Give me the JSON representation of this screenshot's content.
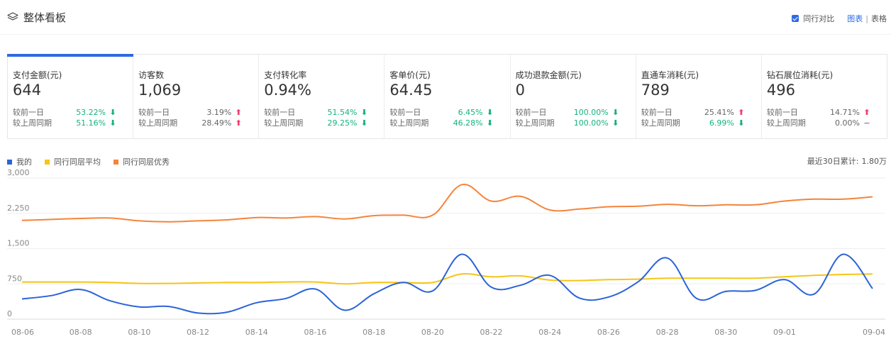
{
  "header": {
    "title": "整体看板",
    "compare_label": "同行对比",
    "compare_checked": true,
    "view_chart": "图表",
    "view_sep": "|",
    "view_table": "表格"
  },
  "cards": [
    {
      "label": "支付金额(元)",
      "value": "644",
      "active": true,
      "rows": [
        {
          "label": "较前一日",
          "pct": "53.22%",
          "dir": "down"
        },
        {
          "label": "较上周同期",
          "pct": "51.16%",
          "dir": "down"
        }
      ]
    },
    {
      "label": "访客数",
      "value": "1,069",
      "active": false,
      "rows": [
        {
          "label": "较前一日",
          "pct": "3.19%",
          "dir": "up"
        },
        {
          "label": "较上周同期",
          "pct": "28.49%",
          "dir": "up"
        }
      ]
    },
    {
      "label": "支付转化率",
      "value": "0.94%",
      "active": false,
      "rows": [
        {
          "label": "较前一日",
          "pct": "51.54%",
          "dir": "down"
        },
        {
          "label": "较上周同期",
          "pct": "29.25%",
          "dir": "down"
        }
      ]
    },
    {
      "label": "客单价(元)",
      "value": "64.45",
      "active": false,
      "rows": [
        {
          "label": "较前一日",
          "pct": "6.45%",
          "dir": "down"
        },
        {
          "label": "较上周同期",
          "pct": "46.28%",
          "dir": "down"
        }
      ]
    },
    {
      "label": "成功退款金额(元)",
      "value": "0",
      "active": false,
      "rows": [
        {
          "label": "较前一日",
          "pct": "100.00%",
          "dir": "down"
        },
        {
          "label": "较上周同期",
          "pct": "100.00%",
          "dir": "down"
        }
      ]
    },
    {
      "label": "直通车消耗(元)",
      "value": "789",
      "active": false,
      "rows": [
        {
          "label": "较前一日",
          "pct": "25.41%",
          "dir": "up"
        },
        {
          "label": "较上周同期",
          "pct": "6.99%",
          "dir": "down"
        }
      ]
    },
    {
      "label": "钻石展位消耗(元)",
      "value": "496",
      "active": false,
      "rows": [
        {
          "label": "较前一日",
          "pct": "14.71%",
          "dir": "up"
        },
        {
          "label": "较上周同期",
          "pct": "0.00%",
          "dir": "flat"
        }
      ]
    }
  ],
  "arrows": {
    "up": "⬆",
    "down": "⬇",
    "flat": "−"
  },
  "summary": {
    "label": "最近30日累计:",
    "value": "1.80万"
  },
  "colors": {
    "mine": "#2b63d9",
    "avg": "#f5c518",
    "top": "#f5843b",
    "up": "#f0416b",
    "down": "#14b37d",
    "accent": "#2d6ae3"
  },
  "chart_data": {
    "type": "line",
    "title": "",
    "xlabel": "",
    "ylabel": "",
    "ylim": [
      0,
      3000
    ],
    "yticks": [
      "3,000",
      "2,250",
      "1,500",
      "750",
      "0"
    ],
    "ytick_values": [
      3000,
      2250,
      1500,
      750,
      0
    ],
    "grid": true,
    "legend_position": "top-left",
    "x": [
      "08-06",
      "08-07",
      "08-08",
      "08-09",
      "08-10",
      "08-11",
      "08-12",
      "08-13",
      "08-14",
      "08-15",
      "08-16",
      "08-17",
      "08-18",
      "08-19",
      "08-20",
      "08-21",
      "08-22",
      "08-23",
      "08-24",
      "08-25",
      "08-26",
      "08-27",
      "08-28",
      "08-29",
      "08-30",
      "08-31",
      "09-01",
      "09-02",
      "09-03",
      "09-04"
    ],
    "xtick_labels": [
      "08-06",
      "08-08",
      "08-10",
      "08-12",
      "08-14",
      "08-16",
      "08-18",
      "08-20",
      "08-22",
      "08-24",
      "08-26",
      "08-28",
      "08-30",
      "09-01",
      "09-04"
    ],
    "series": [
      {
        "name": "我的",
        "color": "#2b63d9",
        "values": [
          430,
          500,
          630,
          390,
          260,
          270,
          130,
          150,
          350,
          440,
          640,
          190,
          540,
          780,
          600,
          1380,
          680,
          720,
          930,
          450,
          470,
          790,
          1300,
          440,
          590,
          610,
          840,
          530,
          1380,
          650
        ]
      },
      {
        "name": "同行同层平均",
        "color": "#f5c518",
        "values": [
          790,
          790,
          790,
          780,
          760,
          760,
          770,
          780,
          780,
          790,
          790,
          750,
          780,
          780,
          780,
          960,
          900,
          920,
          830,
          820,
          840,
          850,
          870,
          870,
          870,
          870,
          900,
          930,
          950,
          960
        ]
      },
      {
        "name": "同行同层优秀",
        "color": "#f5843b",
        "values": [
          2100,
          2120,
          2140,
          2150,
          2090,
          2070,
          2090,
          2110,
          2160,
          2150,
          2180,
          2130,
          2200,
          2210,
          2210,
          2860,
          2510,
          2610,
          2320,
          2340,
          2390,
          2400,
          2440,
          2410,
          2430,
          2430,
          2510,
          2550,
          2550,
          2600
        ]
      }
    ]
  }
}
